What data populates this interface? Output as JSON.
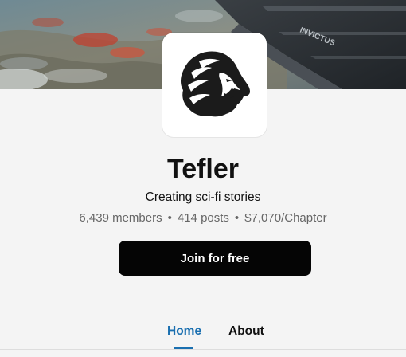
{
  "creator": {
    "name": "Tefler",
    "tagline": "Creating sci-fi stories",
    "banner_ship_text": "INVICTUS"
  },
  "stats": {
    "members": "6,439 members",
    "posts": "414 posts",
    "price": "$7,070/Chapter",
    "separator": "•"
  },
  "actions": {
    "join_label": "Join for free"
  },
  "tabs": [
    {
      "label": "Home",
      "active": true
    },
    {
      "label": "About",
      "active": false
    }
  ],
  "colors": {
    "accent": "#1a6fb0",
    "button_bg": "#050505",
    "page_bg": "#f4f4f4"
  },
  "icons": {
    "avatar": "lion-head-logo"
  }
}
